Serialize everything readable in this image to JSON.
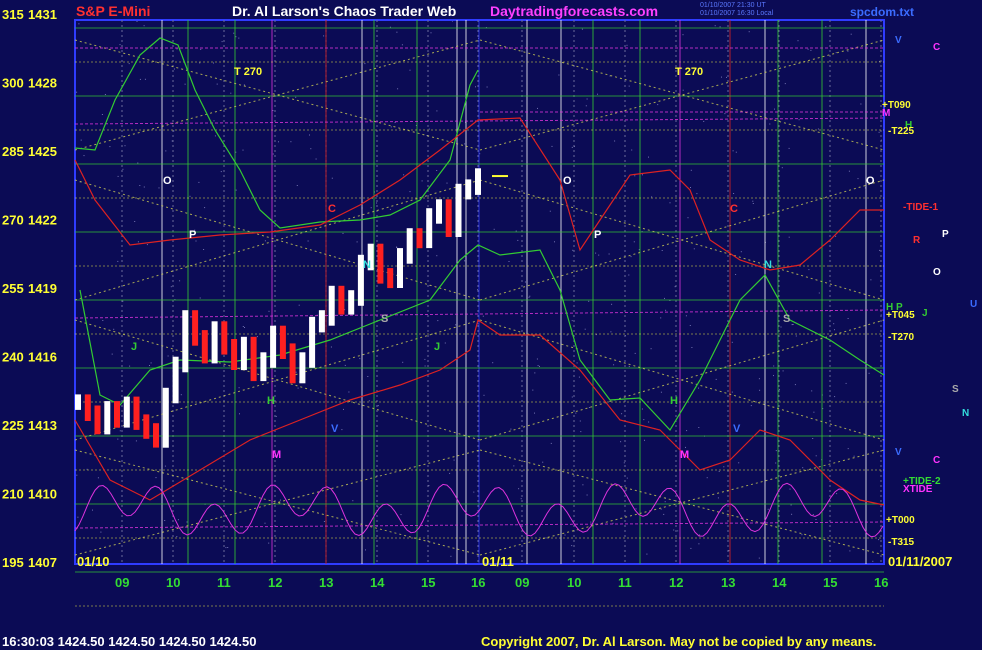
{
  "header": {
    "left": "S&P E-Mini",
    "center": "Dr. Al Larson's Chaos Trader Web",
    "site": "Daytradingforecasts.com",
    "file": "spcdom.txt",
    "timestamp_line1": "01/10/2007 21:30 UT",
    "timestamp_line2": "01/10/2007 16:30 Local"
  },
  "footer": {
    "status": "16:30:03 1424.50 1424.50 1424.50 1424.50",
    "copyright": "Copyright 2007, Dr. Al Larson. May not be copied by any means."
  },
  "colors": {
    "background": "#0b0b55",
    "frame": "#2f3cff",
    "price_up": "#ffffff",
    "price_down": "#ff2020",
    "green_flux": "#33cc33",
    "red_flux": "#dd2222",
    "magenta_flux": "#dd33dd",
    "grid_yellow": "#dddd55",
    "axis_text": "#ffff33",
    "time_text": "#33dd33"
  },
  "chart_data": {
    "type": "candlestick",
    "y_axis": [
      {
        "left": "315",
        "right": "1431"
      },
      {
        "left": "300",
        "right": "1428"
      },
      {
        "left": "285",
        "right": "1425"
      },
      {
        "left": "270",
        "right": "1422"
      },
      {
        "left": "255",
        "right": "1419"
      },
      {
        "left": "240",
        "right": "1416"
      },
      {
        "left": "225",
        "right": "1413"
      },
      {
        "left": "210",
        "right": "1410"
      },
      {
        "left": "195",
        "right": "1407"
      }
    ],
    "ylim": [
      1407,
      1431
    ],
    "x_hours": [
      "09",
      "10",
      "11",
      "12",
      "13",
      "14",
      "15",
      "16",
      "09",
      "10",
      "11",
      "12",
      "13",
      "14",
      "15",
      "16"
    ],
    "date_labels": [
      "01/10",
      "01/11",
      "01/11/2007"
    ],
    "last_price": 1424.5,
    "price_series": [
      1414.3,
      1413.8,
      1413.2,
      1414.0,
      1413.5,
      1414.2,
      1413.4,
      1413.0,
      1412.6,
      1414.6,
      1416.0,
      1418.1,
      1417.2,
      1416.4,
      1417.6,
      1416.8,
      1416.1,
      1416.9,
      1415.6,
      1416.2,
      1417.4,
      1416.6,
      1415.5,
      1416.2,
      1417.8,
      1418.1,
      1419.2,
      1418.6,
      1419.0,
      1420.6,
      1421.1,
      1420.0,
      1419.8,
      1420.9,
      1421.8,
      1421.6,
      1422.7,
      1423.1,
      1422.1,
      1423.8,
      1424.0,
      1424.5
    ],
    "markers": [
      {
        "text": "O",
        "color": "#ffffff"
      },
      {
        "text": "P",
        "color": "#ffffff"
      },
      {
        "text": "C",
        "color": "#ff3030"
      },
      {
        "text": "N",
        "color": "#33dddd"
      },
      {
        "text": "S",
        "color": "#aaaaaa"
      },
      {
        "text": "J",
        "color": "#33cc33"
      },
      {
        "text": "H",
        "color": "#33cc33"
      },
      {
        "text": "M",
        "color": "#ff33ff"
      },
      {
        "text": "V",
        "color": "#3b6cff"
      },
      {
        "text": "T 270",
        "color": "#ffff33"
      }
    ],
    "right_labels": [
      {
        "text": "V",
        "color": "#3b6cff"
      },
      {
        "text": "C",
        "color": "#ff33ff"
      },
      {
        "text": "+T090",
        "color": "#ffff33"
      },
      {
        "text": "M",
        "color": "#ff33ff"
      },
      {
        "text": "H",
        "color": "#33cc33"
      },
      {
        "text": "-T225",
        "color": "#ffff33"
      },
      {
        "text": "-TIDE-1",
        "color": "#ff3030"
      },
      {
        "text": "R",
        "color": "#ff3030"
      },
      {
        "text": "P",
        "color": "#ffffff"
      },
      {
        "text": "O",
        "color": "#ffffff"
      },
      {
        "text": "H P",
        "color": "#33cc33"
      },
      {
        "text": "J",
        "color": "#33cc33"
      },
      {
        "text": "U",
        "color": "#3b6cff"
      },
      {
        "text": "+T045",
        "color": "#ffff33"
      },
      {
        "text": "-T270",
        "color": "#ffff33"
      },
      {
        "text": "S",
        "color": "#aaaaaa"
      },
      {
        "text": "N",
        "color": "#33dddd"
      },
      {
        "text": "V",
        "color": "#3b6cff"
      },
      {
        "text": "C",
        "color": "#ff33ff"
      },
      {
        "text": "+TIDE-2",
        "color": "#33dd33"
      },
      {
        "text": "XTIDE",
        "color": "#ff33ff"
      },
      {
        "text": "+T000",
        "color": "#ffff33"
      },
      {
        "text": "-T315",
        "color": "#ffff33"
      }
    ]
  }
}
